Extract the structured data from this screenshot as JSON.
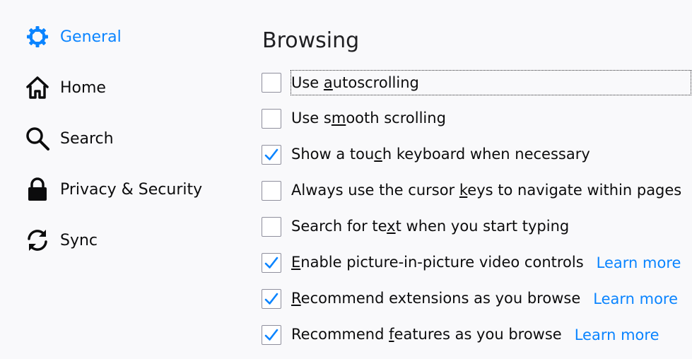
{
  "sidebar": {
    "items": [
      {
        "label": "General",
        "icon": "gear-icon",
        "selected": true
      },
      {
        "label": "Home",
        "icon": "home-icon",
        "selected": false
      },
      {
        "label": "Search",
        "icon": "search-icon",
        "selected": false
      },
      {
        "label": "Privacy & Security",
        "icon": "lock-icon",
        "selected": false
      },
      {
        "label": "Sync",
        "icon": "sync-icon",
        "selected": false
      }
    ]
  },
  "main": {
    "section_title": "Browsing",
    "learn_more_label": "Learn more",
    "options": [
      {
        "pre": "Use ",
        "key": "a",
        "post": "utoscrolling",
        "checked": false,
        "learn_more": false,
        "focused": true
      },
      {
        "pre": "Use s",
        "key": "m",
        "post": "ooth scrolling",
        "checked": false,
        "learn_more": false,
        "focused": false
      },
      {
        "pre": "Show a tou",
        "key": "c",
        "post": "h keyboard when necessary",
        "checked": true,
        "learn_more": false,
        "focused": false
      },
      {
        "pre": "Always use the cursor ",
        "key": "k",
        "post": "eys to navigate within pages",
        "checked": false,
        "learn_more": false,
        "focused": false
      },
      {
        "pre": "Search for te",
        "key": "x",
        "post": "t when you start typing",
        "checked": false,
        "learn_more": false,
        "focused": false
      },
      {
        "pre": "",
        "key": "E",
        "post": "nable picture-in-picture video controls",
        "checked": true,
        "learn_more": true,
        "focused": false
      },
      {
        "pre": "",
        "key": "R",
        "post": "ecommend extensions as you browse",
        "checked": true,
        "learn_more": true,
        "focused": false
      },
      {
        "pre": "Recommend ",
        "key": "f",
        "post": "eatures as you browse",
        "checked": true,
        "learn_more": true,
        "focused": false
      }
    ]
  },
  "colors": {
    "accent": "#0a84ff",
    "background": "#f9f9fb",
    "text": "#0c0c0d"
  }
}
